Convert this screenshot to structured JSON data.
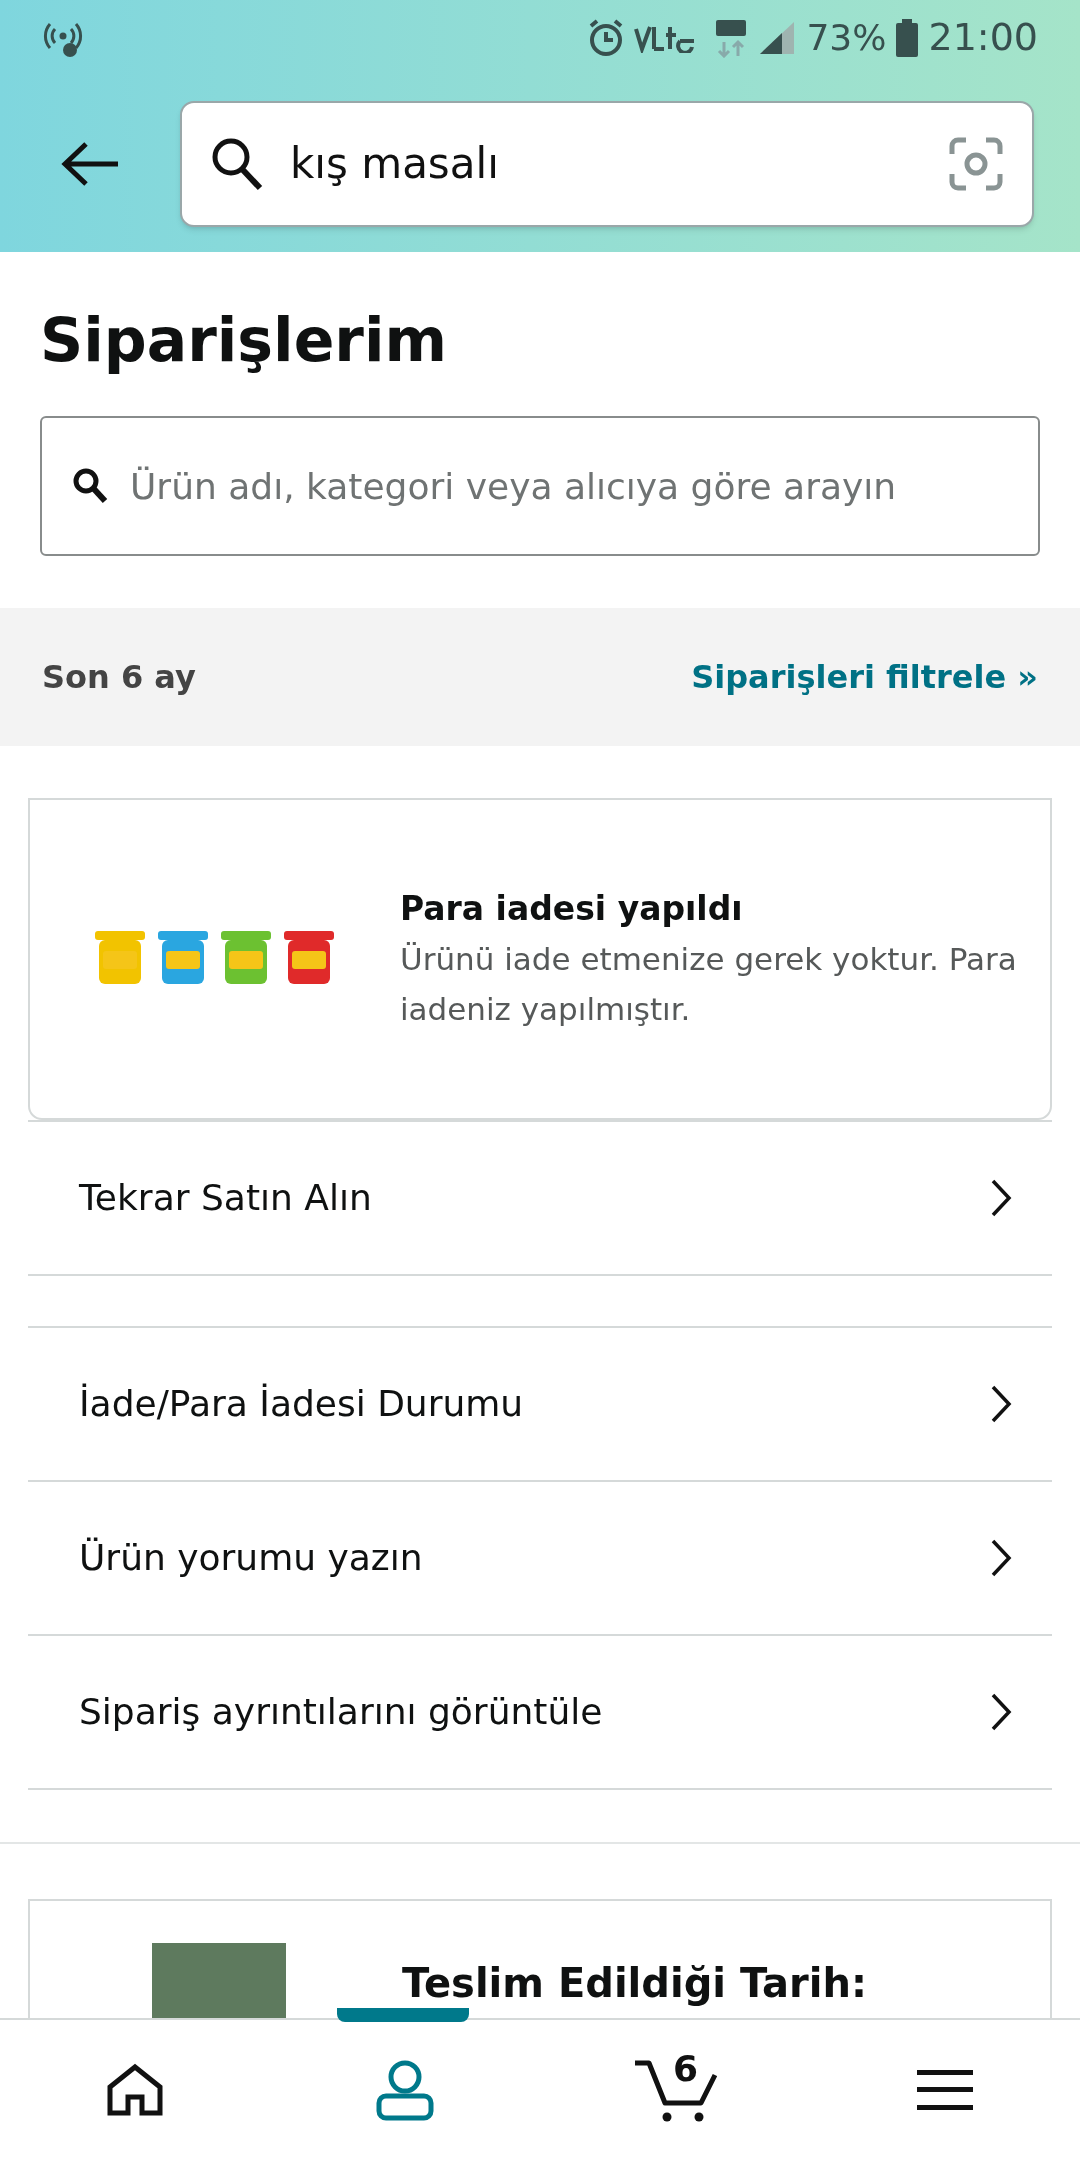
{
  "status_bar": {
    "battery": "73%",
    "time": "21:00"
  },
  "search": {
    "value": "kış masalı"
  },
  "page_title": "Siparişlerim",
  "order_search": {
    "placeholder": "Ürün adı, kategori veya alıcıya göre arayın"
  },
  "filter_bar": {
    "period": "Son 6 ay",
    "filter_link": "Siparişleri filtrele »"
  },
  "orders": [
    {
      "kind": "refund",
      "status": "Para iadesi yapıldı",
      "message": "Ürünü iade etmenize gerek yoktur. Para iadeniz yapılmıştır.",
      "action_groups": [
        [
          "Tekrar Satın Alın"
        ],
        [
          "İade/Para İadesi Durumu",
          "Ürün yorumu yazın",
          "Sipariş ayrıntılarını görüntüle"
        ]
      ]
    },
    {
      "kind": "book",
      "status": "Teslim Edildiği Tarih:"
    }
  ],
  "bottom_nav": [
    {
      "kind": "home",
      "selected": false
    },
    {
      "kind": "account",
      "selected": true
    },
    {
      "kind": "cart",
      "selected": false,
      "count": "6"
    },
    {
      "kind": "menu",
      "selected": false
    }
  ]
}
